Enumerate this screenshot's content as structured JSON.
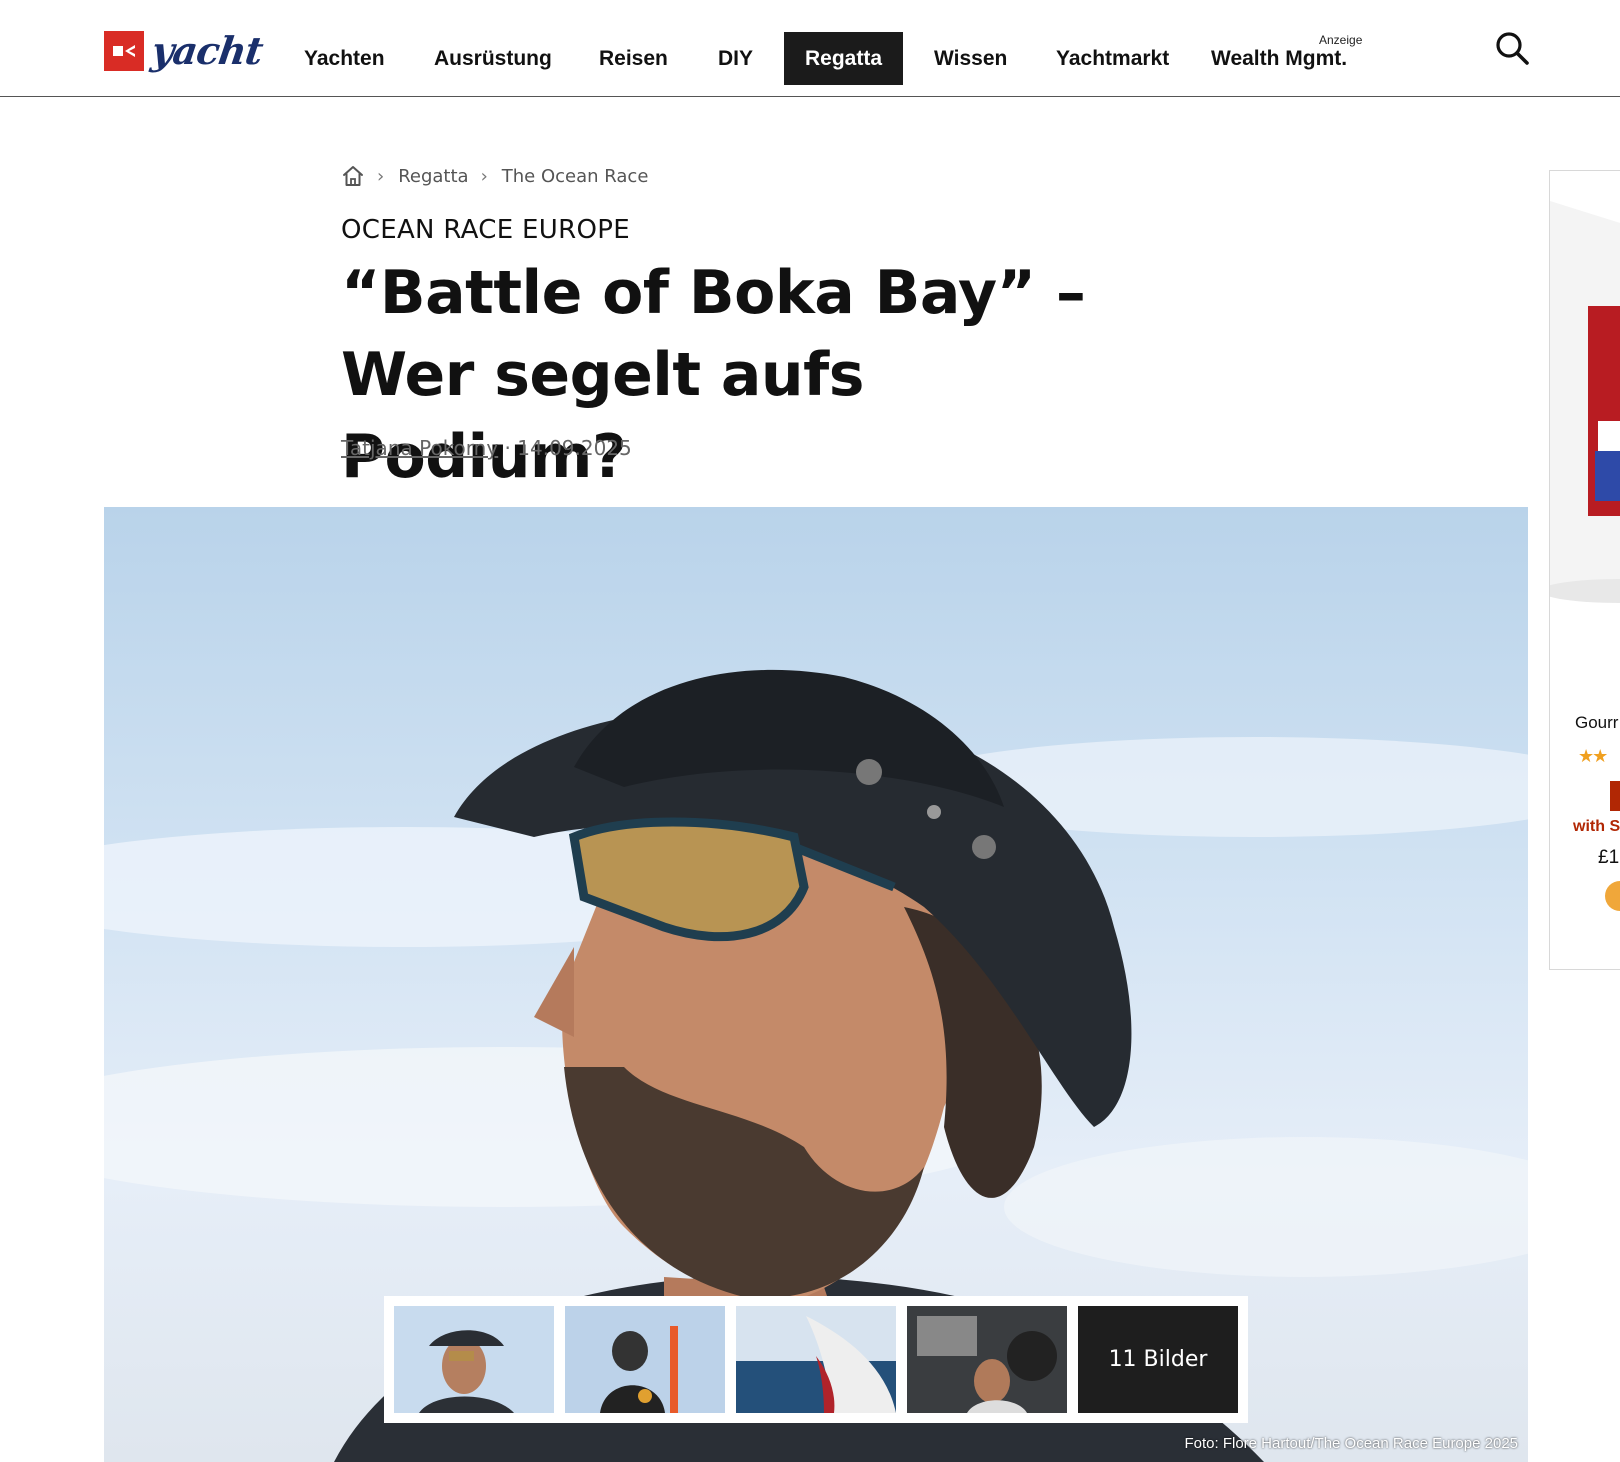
{
  "header": {
    "logo_text": "yacht",
    "nav": [
      {
        "label": "Yachten"
      },
      {
        "label": "Ausrüstung"
      },
      {
        "label": "Reisen"
      },
      {
        "label": "DIY"
      },
      {
        "label": "Regatta",
        "active": true
      },
      {
        "label": "Wissen"
      },
      {
        "label": "Yachtmarkt"
      },
      {
        "label": "Wealth Mgmt."
      }
    ],
    "ad_label": "Anzeige",
    "search_icon": "search-icon"
  },
  "breadcrumb": {
    "home_icon": "home-icon",
    "items": [
      "Regatta",
      "The Ocean Race"
    ]
  },
  "article": {
    "kicker": "OCEAN RACE EUROPE",
    "headline": "“Battle of Boka Bay” – Wer segelt aufs Podium?",
    "author": "Tatjana Pokorny",
    "date": "· 14.09.2025"
  },
  "hero": {
    "gallery_more": "11 Bilder",
    "credit": "Foto: Flore Hartout/The Ocean Race Europe 2025"
  },
  "side_ad": {
    "title": "Gourr",
    "stars": "★★",
    "promo": "with S",
    "price": "£1"
  },
  "colors": {
    "brand_red": "#d92c25",
    "brand_navy": "#1a2f6b",
    "active_nav_bg": "#1b1b1b"
  }
}
